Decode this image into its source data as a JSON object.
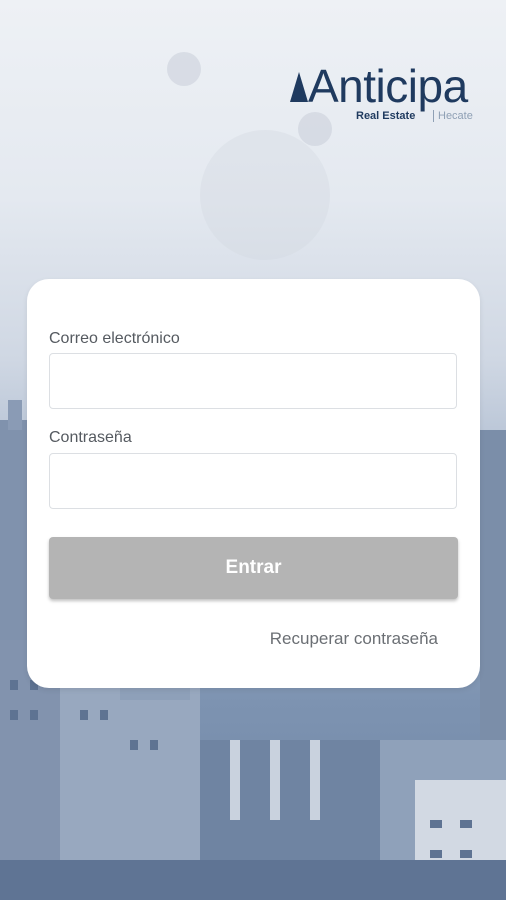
{
  "brand": {
    "name": "Anticipa",
    "sub_left": "Real Estate",
    "sub_right": "Hecate"
  },
  "form": {
    "email_label": "Correo electrónico",
    "email_value": "",
    "password_label": "Contraseña",
    "password_value": "",
    "submit_label": "Entrar",
    "recover_label": "Recuperar contraseña"
  },
  "colors": {
    "brand": "#1f3a5f",
    "button_disabled": "#b4b4b4"
  }
}
